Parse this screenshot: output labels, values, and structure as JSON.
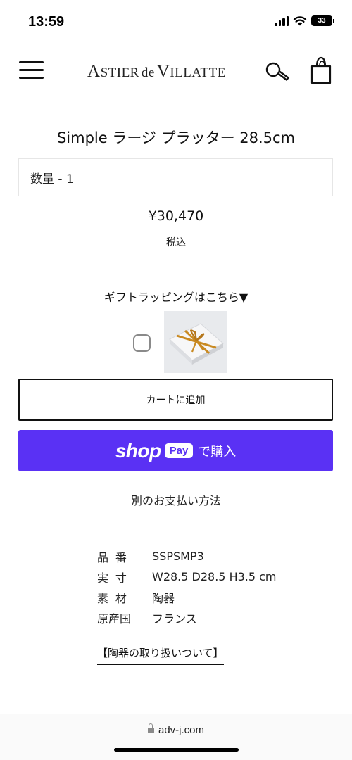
{
  "status_bar": {
    "time": "13:59",
    "battery_level": "33",
    "icons": [
      "signal-icon",
      "wifi-icon",
      "battery-icon"
    ]
  },
  "header": {
    "logo_parts": {
      "a_cap": "A",
      "a_rest": "STIER",
      "de": "de",
      "v_cap": "V",
      "v_rest": "ILLATTE"
    },
    "icons": [
      "menu-icon",
      "search-icon",
      "shopping-bag-icon"
    ]
  },
  "product": {
    "title": "Simple ラージ プラッター 28.5cm",
    "quantity_label": "数量 - 1",
    "price": "¥30,470",
    "tax_note": "税込",
    "gift_wrapping_label": "ギフトラッピングはこちら▼",
    "gift_wrapping_checked": false,
    "add_to_cart_label": "カートに追加",
    "shop_pay": {
      "shop_text": "shop",
      "pay_text": "Pay",
      "suffix": "で購入",
      "color": "#5a31f4"
    },
    "other_payment_label": "別のお支払い方法"
  },
  "specs": [
    {
      "label": "品番",
      "value": "SSPSMP3"
    },
    {
      "label": "実寸",
      "value": "W28.5 D28.5 H3.5 cm"
    },
    {
      "label": "素材",
      "value": "陶器"
    },
    {
      "label": "原産国",
      "value": "フランス"
    }
  ],
  "care_link_label": "【陶器の取り扱いついて】",
  "browser": {
    "url": "adv-j.com"
  }
}
